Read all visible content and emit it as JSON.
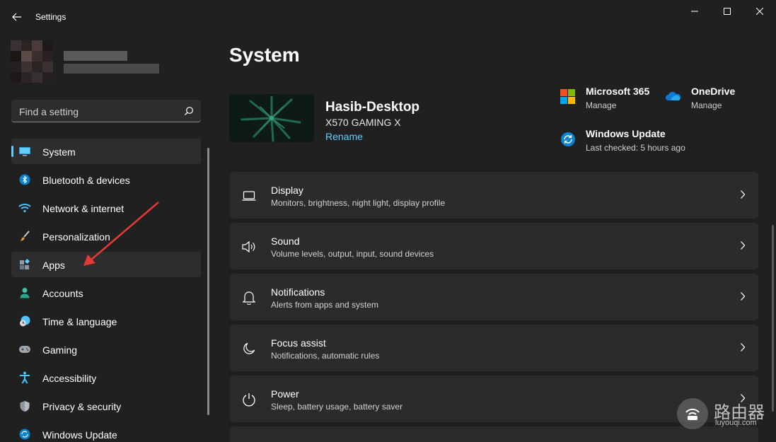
{
  "window": {
    "app_title": "Settings"
  },
  "search": {
    "placeholder": "Find a setting"
  },
  "sidebar": {
    "items": [
      {
        "label": "System",
        "icon": "monitor-icon"
      },
      {
        "label": "Bluetooth & devices",
        "icon": "bluetooth-icon"
      },
      {
        "label": "Network & internet",
        "icon": "wifi-icon"
      },
      {
        "label": "Personalization",
        "icon": "brush-icon"
      },
      {
        "label": "Apps",
        "icon": "apps-icon"
      },
      {
        "label": "Accounts",
        "icon": "person-icon"
      },
      {
        "label": "Time & language",
        "icon": "clock-globe-icon"
      },
      {
        "label": "Gaming",
        "icon": "gamepad-icon"
      },
      {
        "label": "Accessibility",
        "icon": "accessibility-icon"
      },
      {
        "label": "Privacy & security",
        "icon": "shield-icon"
      },
      {
        "label": "Windows Update",
        "icon": "update-icon"
      }
    ],
    "active_index": 0
  },
  "main": {
    "title": "System",
    "device": {
      "name": "Hasib-Desktop",
      "model": "X570 GAMING X",
      "rename_label": "Rename"
    },
    "quick_links": [
      {
        "title": "Microsoft 365",
        "subtitle": "Manage",
        "icon": "microsoft-365-icon"
      },
      {
        "title": "OneDrive",
        "subtitle": "Manage",
        "icon": "onedrive-icon"
      },
      {
        "title": "Windows Update",
        "subtitle": "Last checked: 5 hours ago",
        "icon": "windows-update-icon"
      }
    ],
    "cards": [
      {
        "title": "Display",
        "subtitle": "Monitors, brightness, night light, display profile",
        "icon": "display-icon"
      },
      {
        "title": "Sound",
        "subtitle": "Volume levels, output, input, sound devices",
        "icon": "speaker-icon"
      },
      {
        "title": "Notifications",
        "subtitle": "Alerts from apps and system",
        "icon": "bell-icon"
      },
      {
        "title": "Focus assist",
        "subtitle": "Notifications, automatic rules",
        "icon": "moon-icon"
      },
      {
        "title": "Power",
        "subtitle": "Sleep, battery usage, battery saver",
        "icon": "power-icon"
      }
    ]
  },
  "watermark": {
    "title": "路由器",
    "url": "luyouqi.com"
  },
  "colors": {
    "background": "#202020",
    "card": "#2b2b2b",
    "accent": "#60cdff"
  }
}
